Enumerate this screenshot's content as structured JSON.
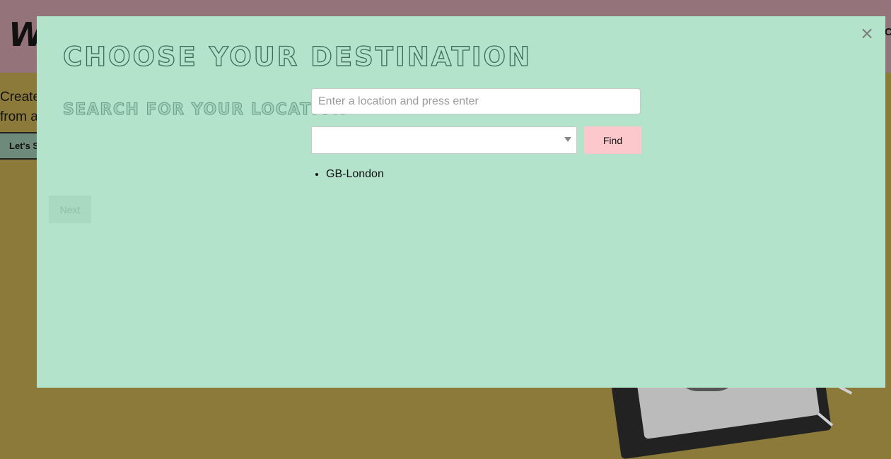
{
  "background": {
    "logo_text": "W",
    "nav_fragment": "C",
    "intro_lines": [
      "Create",
      "from a"
    ],
    "cta_label": "Let's S"
  },
  "modal": {
    "close_glyph": "×",
    "title": "CHOOSE YOUR DESTINATION",
    "search_label": "SEARCH FOR YOUR LOCATION",
    "location_input": {
      "value": "",
      "placeholder": "Enter a location and press enter"
    },
    "select": {
      "selected": ""
    },
    "find_label": "Find",
    "results": [
      "GB-London"
    ],
    "next_label": "Next"
  },
  "colors": {
    "modal_bg": "#b3e3cb",
    "header_bg": "#94737a",
    "page_bg": "#8c7a3a",
    "find_button": "#fcc8cc"
  }
}
